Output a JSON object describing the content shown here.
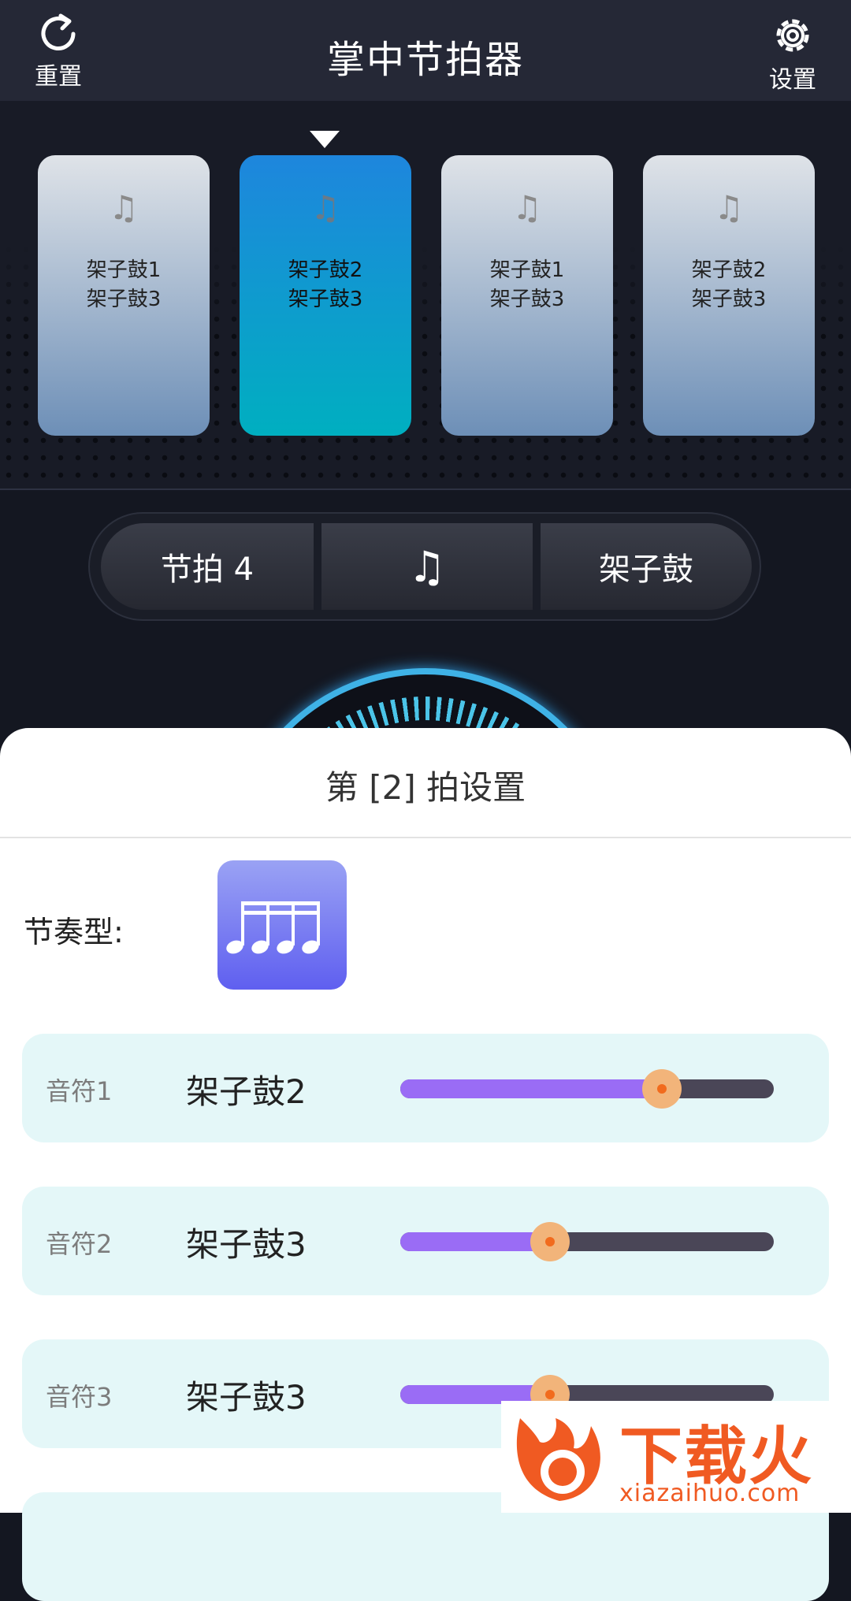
{
  "header": {
    "title": "掌中节拍器",
    "reset_label": "重置",
    "settings_label": "设置"
  },
  "beat_cards": [
    {
      "note": "♫",
      "line1": "架子鼓1",
      "line2": "架子鼓3",
      "active": false
    },
    {
      "note": "♫",
      "line1": "架子鼓2",
      "line2": "架子鼓3",
      "active": true
    },
    {
      "note": "♫",
      "line1": "架子鼓1",
      "line2": "架子鼓3",
      "active": false
    },
    {
      "note": "♫",
      "line1": "架子鼓2",
      "line2": "架子鼓3",
      "active": false
    }
  ],
  "controls": {
    "beat_label": "节拍 4",
    "note_icon": "♫",
    "instrument_label": "架子鼓"
  },
  "sheet": {
    "title": "第 [2] 拍设置",
    "rhythm_label": "节奏型:",
    "rhythm_icon": "four-sixteenth-notes-icon",
    "notes": [
      {
        "label": "音符1",
        "value": "架子鼓2",
        "volume": 0.7
      },
      {
        "label": "音符2",
        "value": "架子鼓3",
        "volume": 0.4
      },
      {
        "label": "音符3",
        "value": "架子鼓3",
        "volume": 0.4
      }
    ]
  },
  "watermark": {
    "brand": "下载火",
    "url": "xiazaihuo.com"
  },
  "colors": {
    "header_bg": "#252836",
    "active_card_top": "#1e86dd",
    "active_card_bottom": "#00afc0",
    "slider_fill": "#9a6cf5",
    "slider_knob": "#f2b47a",
    "row_bg": "#e4f7f8"
  }
}
